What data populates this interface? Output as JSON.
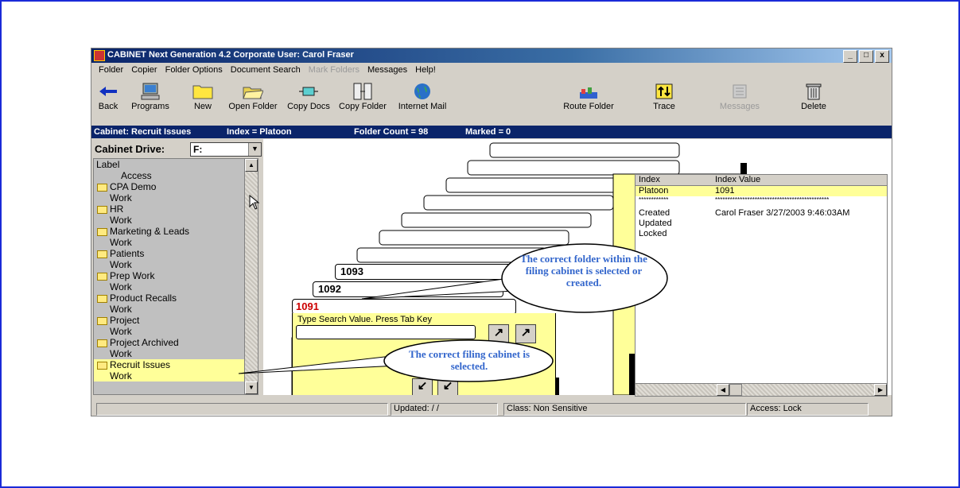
{
  "window": {
    "title": "CABINET Next Generation  4.2 Corporate    User: Carol Fraser",
    "buttons": [
      "_",
      "□",
      "x"
    ]
  },
  "menu": [
    "Folder",
    "Copier",
    "Folder Options",
    "Document Search",
    "Mark Folders",
    "Messages",
    "Help!"
  ],
  "toolbar": [
    {
      "label": "Back",
      "icon": "back-arrow-icon"
    },
    {
      "label": "Programs",
      "icon": "computer-icon"
    },
    {
      "label": "New",
      "icon": "new-folder-icon"
    },
    {
      "label": "Open Folder",
      "icon": "open-folder-icon"
    },
    {
      "label": "Copy Docs",
      "icon": "copy-docs-icon"
    },
    {
      "label": "Copy Folder",
      "icon": "copy-folder-icon"
    },
    {
      "label": "Internet Mail",
      "icon": "globe-mail-icon"
    },
    {
      "label": "Route Folder",
      "icon": "route-folder-icon"
    },
    {
      "label": "Trace",
      "icon": "trace-icon"
    },
    {
      "label": "Messages",
      "icon": "messages-icon"
    },
    {
      "label": "Delete",
      "icon": "trash-icon"
    }
  ],
  "infobar": {
    "cabinet": "Cabinet: Recruit Issues",
    "index": "Index = Platoon",
    "folder_count": "Folder Count = 98",
    "marked": "Marked = 0"
  },
  "sidebar": {
    "drive_label": "Cabinet Drive:",
    "drive_value": "F:",
    "header_label": "Label",
    "header_access": "Access",
    "items": [
      {
        "label": "CPA Demo",
        "access": "Work"
      },
      {
        "label": "HR",
        "access": "Work"
      },
      {
        "label": "Marketing & Leads",
        "access": "Work"
      },
      {
        "label": "Patients",
        "access": "Work"
      },
      {
        "label": "Prep Work",
        "access": "Work"
      },
      {
        "label": "Product Recalls",
        "access": "Work"
      },
      {
        "label": "Project",
        "access": "Work"
      },
      {
        "label": "Project Archived",
        "access": "Work"
      },
      {
        "label": "Recruit Issues",
        "access": "Work"
      }
    ]
  },
  "folders": {
    "tabs": [
      "1093",
      "1092",
      "1091"
    ],
    "search_label": "Type Search Value. Press Tab Key",
    "search_value": ""
  },
  "detail": {
    "col_index": "Index",
    "col_value": "Index Value",
    "index_name": "Platoon",
    "index_value": "1091",
    "stars_left": "************",
    "stars_right": "**********************************************",
    "created_label": "Created",
    "created_value": "Carol Fraser  3/27/2003  9:46:03AM",
    "updated_label": "Updated",
    "locked_label": "Locked"
  },
  "callouts": {
    "folder": "The correct folder within the filing cabinet is selected or created.",
    "cabinet": "The correct filing cabinet is selected."
  },
  "statusbar": {
    "updated": "Updated:  /  /",
    "class": "Class: Non Sensitive",
    "access": "Access: Lock"
  },
  "colors": {
    "folder_yellow": "#ffff99",
    "title_blue": "#0a246a",
    "frame_blue": "#1a2ad8",
    "callout_text": "#3366cc",
    "active_tab": "#cc0000"
  }
}
